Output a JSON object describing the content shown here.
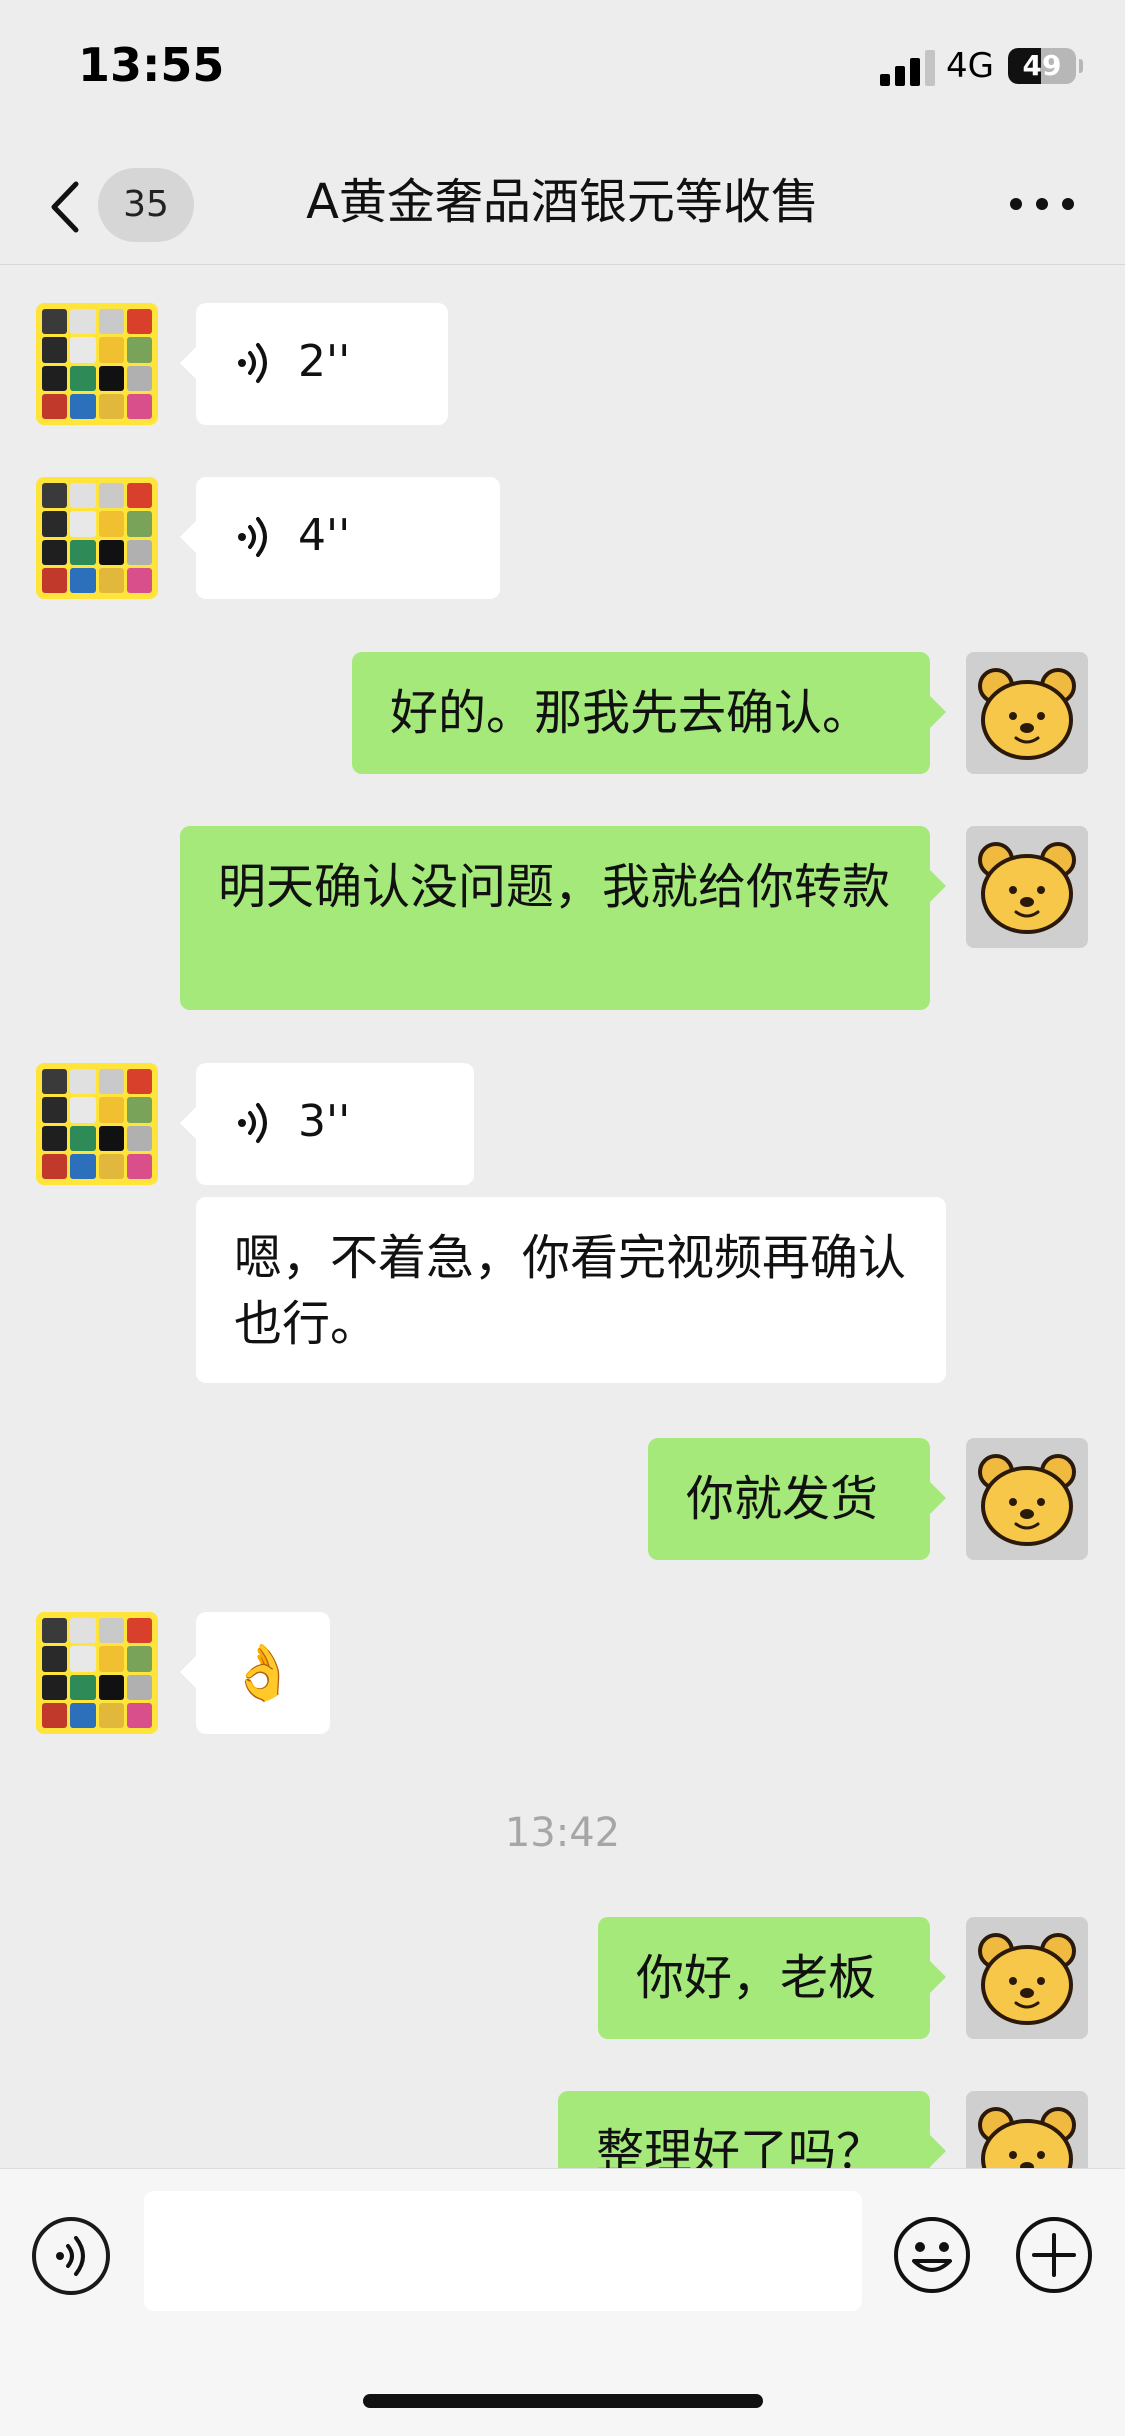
{
  "status_bar": {
    "time": "13:55",
    "network": "4G",
    "battery": "49",
    "battery_level": 0.49,
    "signal_bars": 3
  },
  "header": {
    "back_badge": "35",
    "title": "A黄金奢品酒银元等收售",
    "more_icon": "more-dots-icon"
  },
  "messages": [
    {
      "type": "voice",
      "direction": "in",
      "duration": "2''"
    },
    {
      "type": "voice",
      "direction": "in",
      "duration": "4''"
    },
    {
      "type": "text",
      "direction": "out",
      "text": "好的。那我先去确认。"
    },
    {
      "type": "text",
      "direction": "out",
      "text": "明天确认没问题，我就给你转款"
    },
    {
      "type": "voice",
      "direction": "in",
      "duration": "3''"
    },
    {
      "type": "text",
      "direction": "in",
      "text": "嗯，不着急，你看完视频再确认也行。"
    },
    {
      "type": "text",
      "direction": "out",
      "text": "你就发货"
    },
    {
      "type": "emoji",
      "direction": "in",
      "emoji": "👌"
    },
    {
      "type": "time",
      "text": "13:42"
    },
    {
      "type": "text",
      "direction": "out",
      "text": "你好，老板"
    },
    {
      "type": "text",
      "direction": "out",
      "text": "整理好了吗？"
    }
  ],
  "input_bar": {
    "voice_icon": "voice-input-icon",
    "emoji_icon": "emoji-icon",
    "plus_icon": "plus-icon",
    "placeholder": ""
  },
  "colors": {
    "background": "#ededed",
    "outgoing_bubble": "#a5e97a",
    "incoming_bubble": "#ffffff",
    "shop_avatar": "#ffe53b"
  }
}
